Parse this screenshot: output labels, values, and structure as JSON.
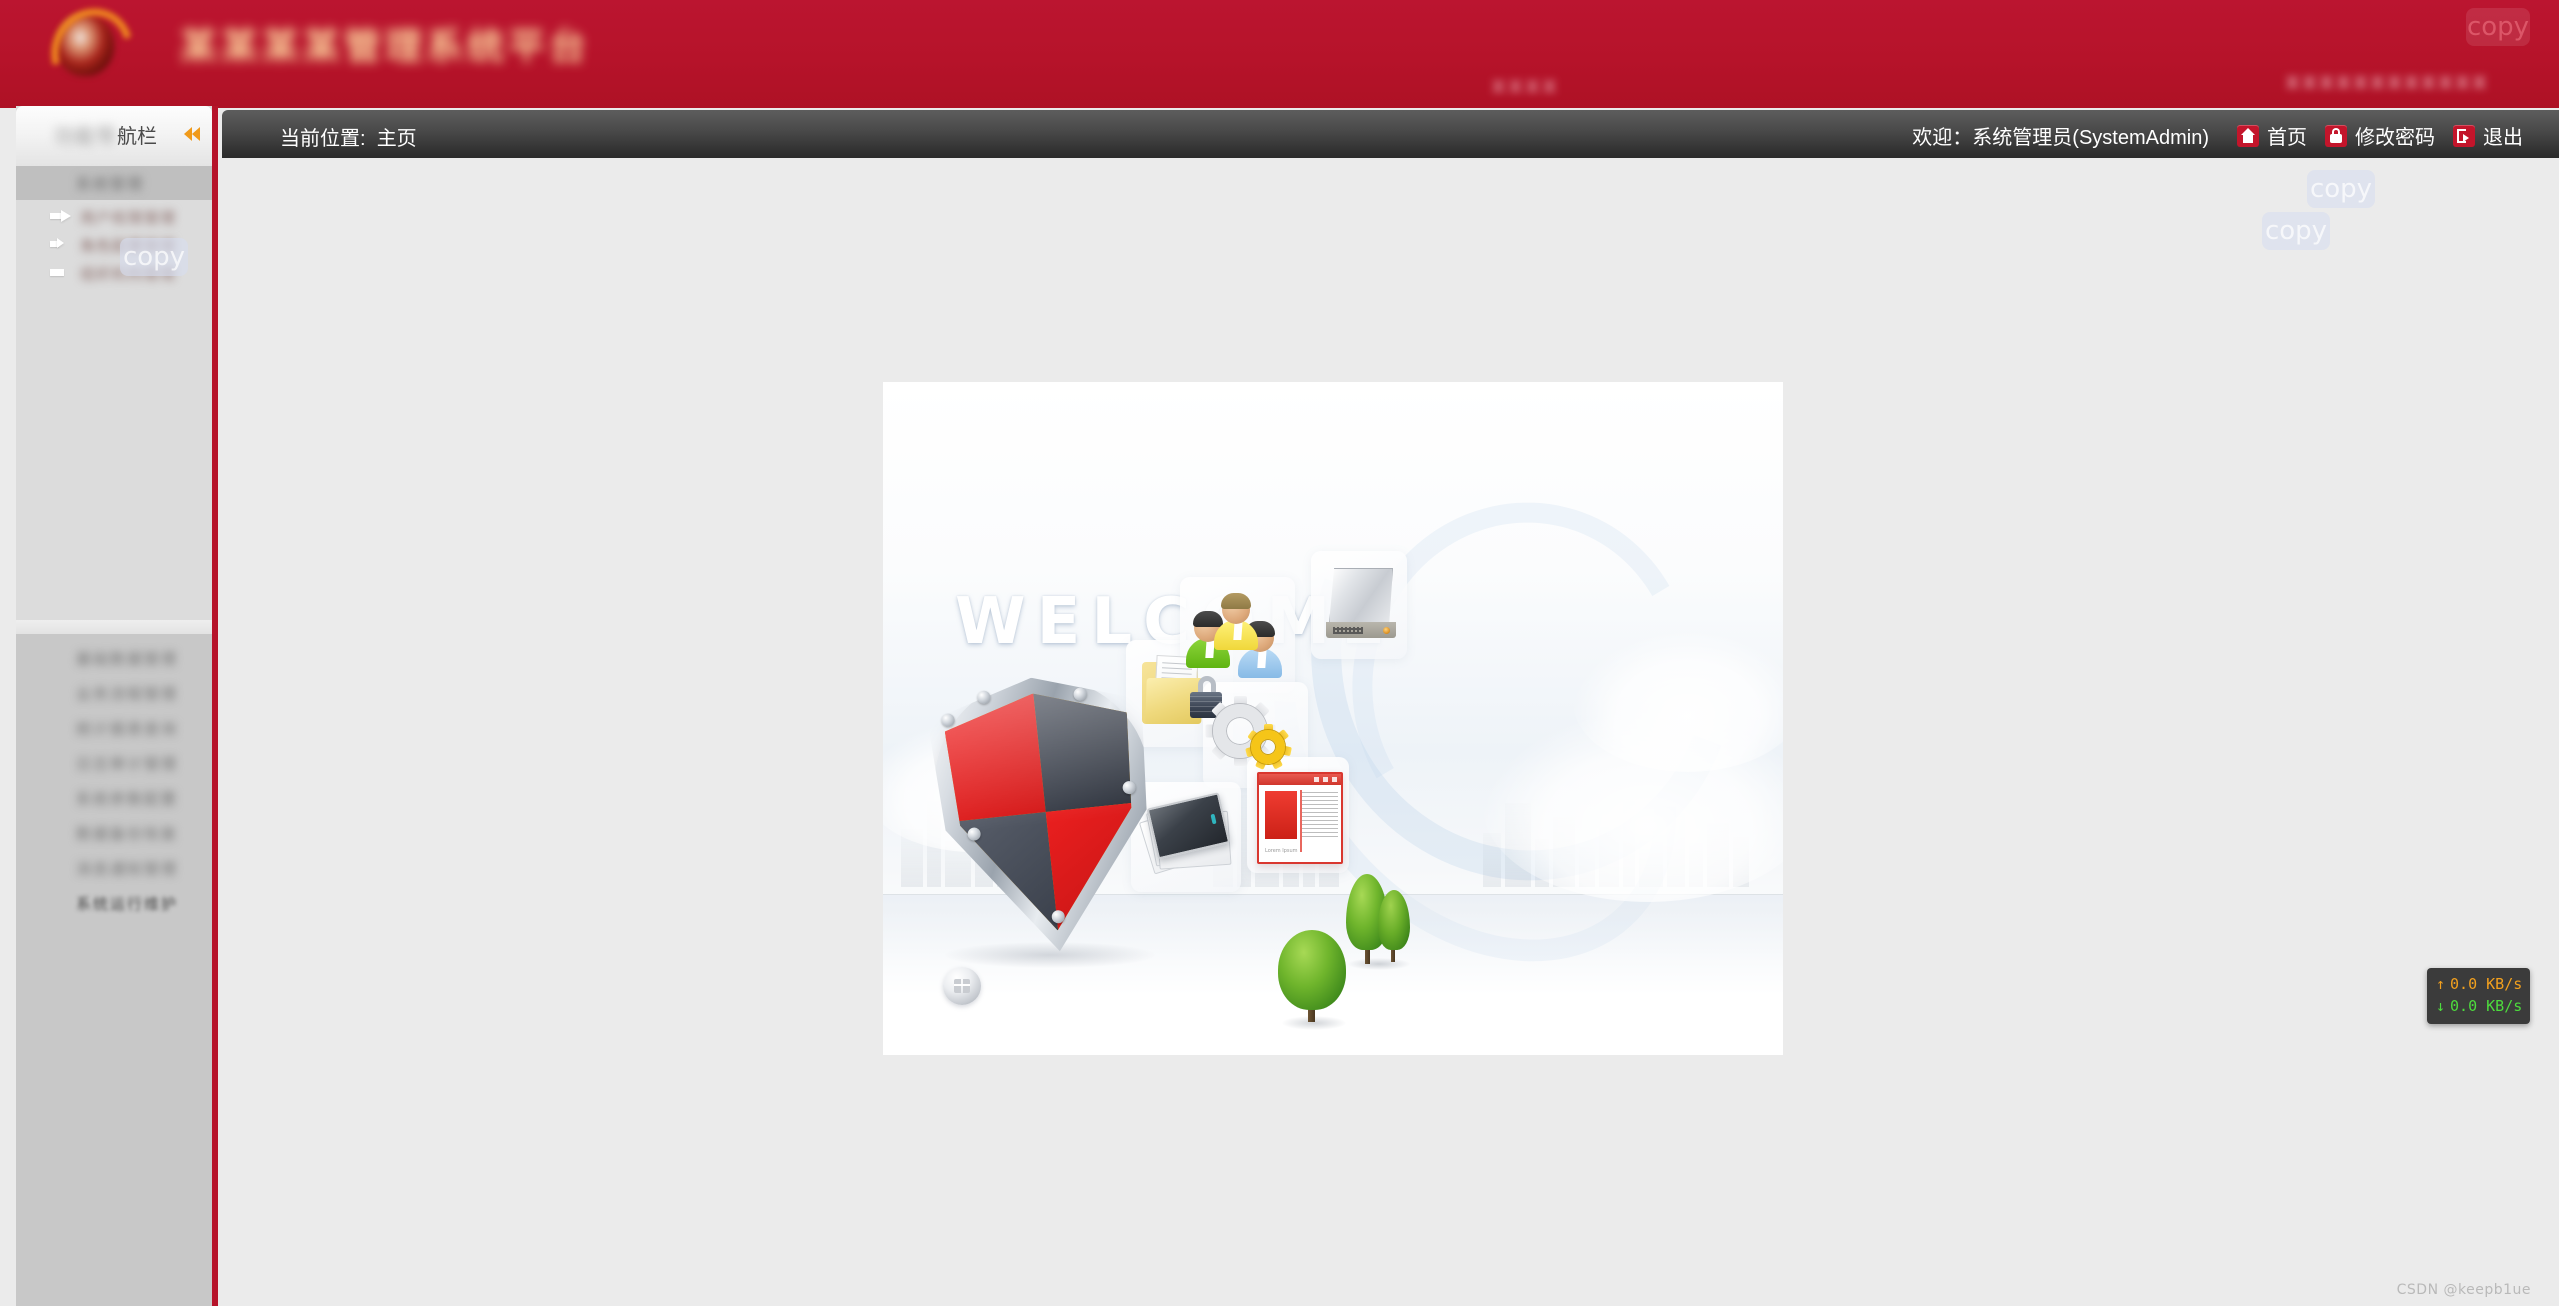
{
  "header": {
    "brand_title_blurred": "某某某某管理系统平台",
    "right_text_blurred": "某某某某某某某某某某某某",
    "right_text_blurred_2": "某某某某",
    "logo_icon": "flame-logo-icon",
    "bg_color": "#b6132a"
  },
  "watermarks": {
    "copy_label": "copy",
    "csdn": "CSDN @keepb1ue"
  },
  "sidebar": {
    "title_blurred_prefix": "功能导",
    "title_suffix": "航栏",
    "collapse_icon": "double-chevron-left-icon",
    "group_title_blurred": "系统管理",
    "items": [
      {
        "label": "用户权限管理",
        "arrow": "arrow-right-icon"
      },
      {
        "label": "角色配置管理",
        "arrow": "arrow-right-icon"
      },
      {
        "label": "组织机构管理",
        "arrow": "arrow-right-icon"
      }
    ],
    "lower_items": [
      {
        "label": "基础数据管理"
      },
      {
        "label": "业务流程管理"
      },
      {
        "label": "统计报表查询"
      },
      {
        "label": "日志审计管理"
      },
      {
        "label": "系统参数配置"
      },
      {
        "label": "数据备份恢复"
      },
      {
        "label": "消息通知管理"
      },
      {
        "label": "系统运行维护"
      }
    ]
  },
  "navbar": {
    "breadcrumb_label": "当前位置:",
    "breadcrumb_value": "主页",
    "welcome": "欢迎：系统管理员(SystemAdmin)",
    "actions": [
      {
        "label": "首页",
        "icon": "home-icon"
      },
      {
        "label": "修改密码",
        "icon": "lock-icon"
      },
      {
        "label": "退出",
        "icon": "logout-icon"
      }
    ]
  },
  "content": {
    "welcome_word": "WELCOME",
    "doc_icon_caption": "Lorem Ipsum",
    "illustration_icons": [
      "shield-icon",
      "locked-folder-icon",
      "users-group-icon",
      "hard-drive-icon",
      "gears-icon",
      "photos-laptop-icon",
      "document-window-icon",
      "globe-button-icon",
      "tree-round-icon",
      "tree-pine-icon"
    ]
  },
  "net_speed": {
    "upload_arrow": "↑",
    "upload_value": "0.0 KB/s",
    "download_arrow": "↓",
    "download_value": "0.0 KB/s",
    "upload_color": "#f2a01e",
    "download_color": "#4ddb3d"
  }
}
